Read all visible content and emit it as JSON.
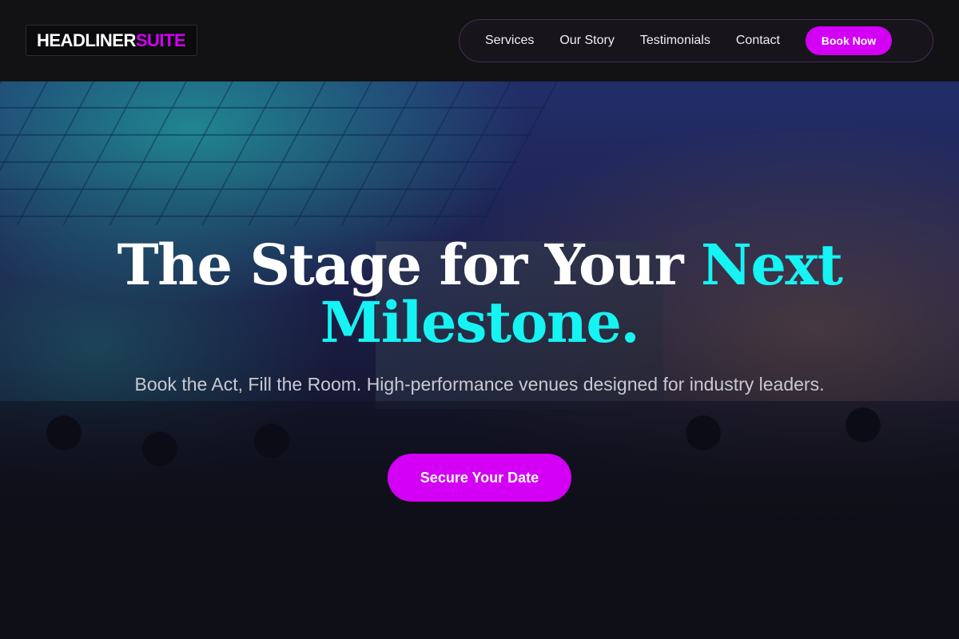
{
  "logo": {
    "part1": "HEADLINER",
    "part2": "SUITE"
  },
  "nav": {
    "items": [
      "Services",
      "Our Story",
      "Testimonials",
      "Contact"
    ],
    "book_label": "Book Now"
  },
  "hero": {
    "headline_white": "The Stage for Your ",
    "headline_accent_1": "Next",
    "headline_accent_2": "Milestone.",
    "subtitle": "Book the Act, Fill the Room. High-performance venues designed for industry leaders.",
    "cta_label": "Secure Your Date"
  },
  "colors": {
    "accent_magenta": "#d400f5",
    "accent_cyan": "#16f3f3",
    "header_bg": "#121214"
  }
}
